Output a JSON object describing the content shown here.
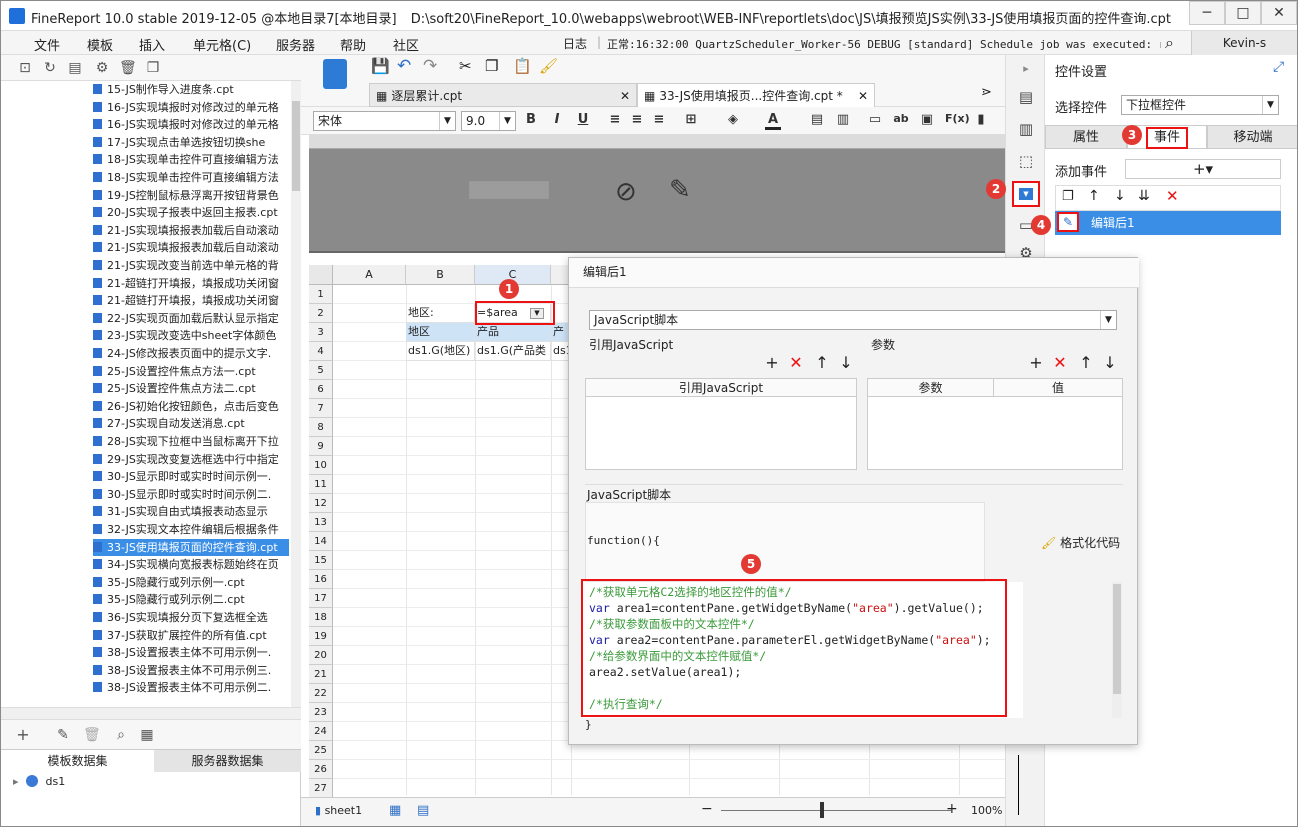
{
  "title_bar": {
    "app_title": "FineReport 10.0 stable 2019-12-05 @本地目录7[本地目录]",
    "file_path": "D:\\soft20\\FineReport_10.0\\webapps\\webroot\\WEB-INF\\reportlets\\doc\\JS\\填报预览JS实例\\33-JS使用填报页面的控件查询.cpt"
  },
  "menu": {
    "items": [
      "文件",
      "模板",
      "插入",
      "单元格(C)",
      "服务器",
      "帮助",
      "社区"
    ],
    "log_label": "日志",
    "log_text": "正常:16:32:00 QuartzScheduler_Worker-56 DEBUG [standard] Schedule job was executed: realTime",
    "user": "Kevin-s"
  },
  "tree": {
    "items": [
      "15-JS制作导入进度条.cpt",
      "16-JS实现填报时对修改过的单元格",
      "16-JS实现填报时对修改过的单元格",
      "17-JS实现点击单选按钮切换she",
      "18-JS实现单击控件可直接编辑方法",
      "18-JS实现单击控件可直接编辑方法",
      "19-JS控制鼠标悬浮离开按钮背景色",
      "20-JS实现子报表中返回主报表.cpt",
      "21-JS实现填报报表加载后自动滚动",
      "21-JS实现填报报表加载后自动滚动",
      "21-JS实现改变当前选中单元格的背",
      "21-超链打开填报，填报成功关闭窗",
      "21-超链打开填报，填报成功关闭窗",
      "22-JS实现页面加载后默认显示指定",
      "23-JS实现改变选中sheet字体颜色",
      "24-JS修改报表页面中的提示文字.",
      "25-JS设置控件焦点方法一.cpt",
      "25-JS设置控件焦点方法二.cpt",
      "26-JS初始化按钮颜色，点击后变色",
      "27-JS实现自动发送消息.cpt",
      "28-JS实现下拉框中当鼠标离开下拉",
      "29-JS实现改变复选框选中行中指定",
      "30-JS显示即时或实时时间示例一.",
      "30-JS显示即时或实时时间示例二.",
      "31-JS实现自由式填报表动态显示",
      "32-JS实现文本控件编辑后根据条件",
      "33-JS使用填报页面的控件查询.cpt",
      "34-JS实现横向宽报表标题始终在页",
      "35-JS隐藏行或列示例一.cpt",
      "35-JS隐藏行或列示例二.cpt",
      "36-JS实现填报分页下复选框全选",
      "37-JS获取扩展控件的所有值.cpt",
      "38-JS设置报表主体不可用示例一.",
      "38-JS设置报表主体不可用示例三.",
      "38-JS设置报表主体不可用示例二."
    ],
    "selected_index": 26
  },
  "datasets": {
    "tab_template": "模板数据集",
    "tab_server": "服务器数据集",
    "items": [
      "ds1"
    ]
  },
  "editor": {
    "tabs": [
      "逐层累计.cpt",
      "33-JS使用填报页...控件查询.cpt *"
    ],
    "font_name": "宋体",
    "font_size": "9.0",
    "columns": [
      "A",
      "B",
      "C"
    ],
    "rows": [
      "1",
      "2",
      "3",
      "4",
      "5",
      "6",
      "7",
      "8",
      "9",
      "10",
      "11",
      "12",
      "13",
      "14",
      "15",
      "16",
      "17",
      "18",
      "19",
      "20",
      "21",
      "22",
      "23",
      "24",
      "25",
      "26",
      "27"
    ],
    "cells": {
      "b2": "地区:",
      "c2": "=$area",
      "b3": "地区",
      "c3": "产品",
      "d3": "产",
      "b4": "ds1.G(地区)",
      "c4": "ds1.G(产品类",
      "d4": "ds1"
    },
    "sheet_tab": "sheet1",
    "zoom": "100%"
  },
  "right_panel": {
    "title": "控件设置",
    "select_widget_label": "选择控件",
    "widget_type": "下拉框控件",
    "tabs": [
      "属性",
      "事件",
      "移动端"
    ],
    "add_event_label": "添加事件",
    "event_item": "编辑后1"
  },
  "dialog": {
    "title": "编辑后1",
    "script_type": "JavaScript脚本",
    "ref_js_label": "引用JavaScript",
    "params_label": "参数",
    "ref_js_col": "引用JavaScript",
    "param_col": "参数",
    "value_col": "值",
    "js_section_label": "JavaScript脚本",
    "function_header": "function(){",
    "format_code": "格式化代码",
    "closing_brace": "}",
    "code_lines": [
      {
        "t": "c",
        "text": "/*获取单元格C2选择的地区控件的值*/"
      },
      {
        "t": "k",
        "text": "var",
        "rest": " area1=contentPane.getWidgetByName(",
        "str": "\"area\"",
        "tail": ").getValue();"
      },
      {
        "t": "c",
        "text": "/*获取参数面板中的文本控件*/"
      },
      {
        "t": "k",
        "text": "var",
        "rest": " area2=contentPane.parameterEl.getWidgetByName(",
        "str": "\"area\"",
        "tail": ");"
      },
      {
        "t": "c",
        "text": "/*给参数界面中的文本控件赋值*/"
      },
      {
        "t": "p",
        "text": "area2.setValue(area1);"
      },
      {
        "t": "p",
        "text": ""
      },
      {
        "t": "c",
        "text": "/*执行查询*/"
      }
    ]
  },
  "callouts": [
    "1",
    "2",
    "3",
    "4",
    "5"
  ],
  "colors": {
    "accent": "#3a8ee6",
    "callout": "#e23a32",
    "highlight_box": "#ee1111"
  }
}
